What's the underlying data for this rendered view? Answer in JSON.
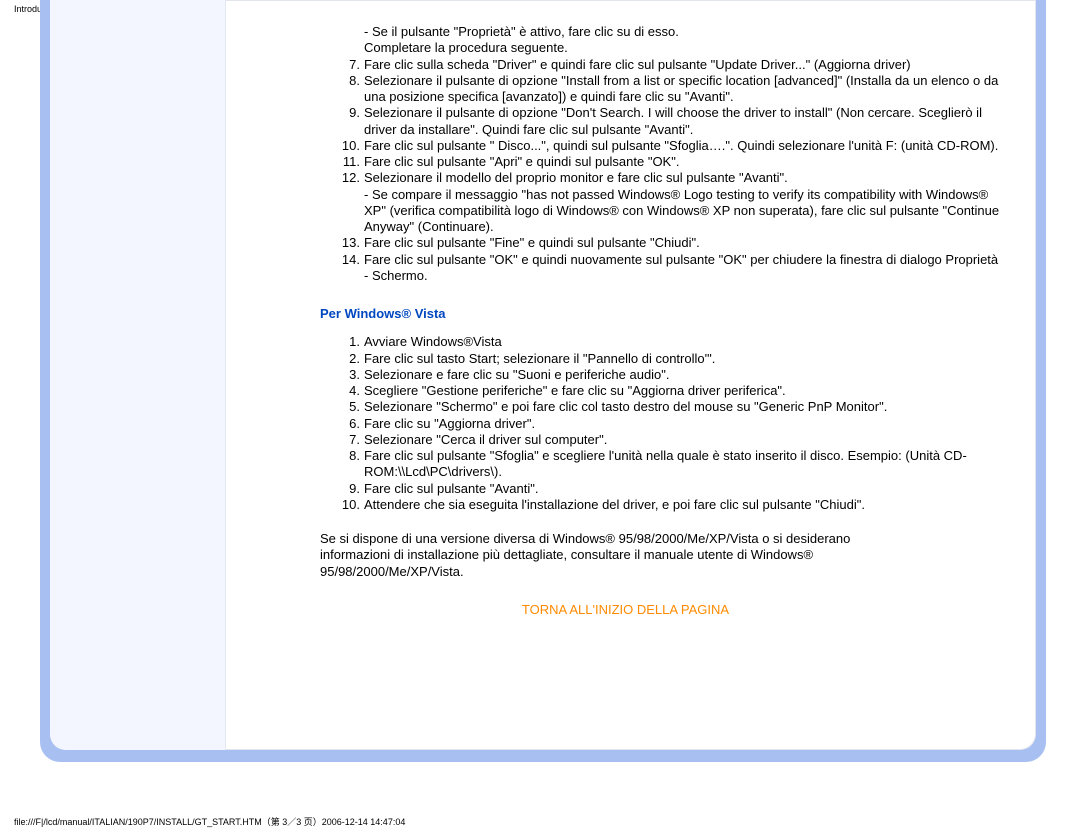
{
  "header": {
    "title": "Introduzione"
  },
  "xp_pre_lines": [
    "- Se il pulsante \"Proprietà\" è attivo, fare clic su di esso.",
    "Completare la procedura seguente."
  ],
  "xp_items": [
    {
      "num": "7.",
      "text": "Fare clic sulla scheda \"Driver\" e quindi fare clic sul pulsante \"Update Driver...\" (Aggiorna driver)"
    },
    {
      "num": "8.",
      "text": "Selezionare il pulsante di opzione \"Install from a list or specific location [advanced]\" (Installa da un elenco o da una posizione specifica [avanzato]) e quindi fare clic su \"Avanti\"."
    },
    {
      "num": "9.",
      "text": "Selezionare il pulsante di opzione \"Don't Search. I will choose the driver to install\" (Non cercare. Sceglierò il driver da installare\". Quindi fare clic sul pulsante \"Avanti\"."
    },
    {
      "num": "10.",
      "text": "Fare clic sul pulsante \" Disco...\", quindi sul pulsante \"Sfoglia….\". Quindi selezionare l'unità F: (unità CD-ROM)."
    },
    {
      "num": "11.",
      "text": "Fare clic sul pulsante \"Apri\" e quindi sul pulsante \"OK\"."
    },
    {
      "num": "12.",
      "text": "Selezionare il modello del proprio monitor e fare clic sul pulsante \"Avanti\".\n- Se compare il messaggio \"has not passed Windows® Logo testing to verify its compatibility with Windows® XP\" (verifica compatibilità logo di Windows® con Windows® XP non superata), fare clic sul pulsante \"Continue Anyway\" (Continuare)."
    },
    {
      "num": "13.",
      "text": "Fare clic sul pulsante \"Fine\" e quindi sul pulsante \"Chiudi\"."
    },
    {
      "num": "14.",
      "text": "Fare clic sul pulsante \"OK\" e quindi nuovamente sul pulsante \"OK\" per chiudere la finestra di dialogo Proprietà - Schermo."
    }
  ],
  "vista_heading": "Per Windows® Vista",
  "vista_items": [
    {
      "num": "1.",
      "text": "Avviare Windows®Vista"
    },
    {
      "num": "2.",
      "text": "Fare clic sul tasto Start; selezionare il \"Pannello di controllo'\"."
    },
    {
      "num": "3.",
      "text": "Selezionare e fare clic su \"Suoni e periferiche audio\"."
    },
    {
      "num": "4.",
      "text": "Scegliere \"Gestione periferiche\" e fare clic su \"Aggiorna driver periferica\"."
    },
    {
      "num": "5.",
      "text": "Selezionare \"Schermo\" e poi fare clic col tasto destro del mouse su \"Generic PnP Monitor\"."
    },
    {
      "num": "6.",
      "text": "Fare clic su \"Aggiorna driver\"."
    },
    {
      "num": "7.",
      "text": "Selezionare \"Cerca il driver sul computer\"."
    },
    {
      "num": "8.",
      "text": "Fare clic sul pulsante \"Sfoglia\" e scegliere l'unità nella quale è stato inserito il disco. Esempio: (Unità CD-ROM:\\\\Lcd\\PC\\drivers\\)."
    },
    {
      "num": "9.",
      "text": "Fare clic sul pulsante \"Avanti\"."
    },
    {
      "num": "10.",
      "text": "Attendere che sia eseguita l'installazione del driver, e poi fare clic sul pulsante \"Chiudi\"."
    }
  ],
  "note": "Se si dispone di una versione diversa di Windows® 95/98/2000/Me/XP/Vista o si desiderano informazioni di installazione più dettagliate, consultare il manuale utente di Windows® 95/98/2000/Me/XP/Vista.",
  "back_link": "TORNA ALL'INIZIO DELLA PAGINA",
  "footer": "file:///F|/lcd/manual/ITALIAN/190P7/INSTALL/GT_START.HTM（第 3／3 页）2006-12-14 14:47:04"
}
